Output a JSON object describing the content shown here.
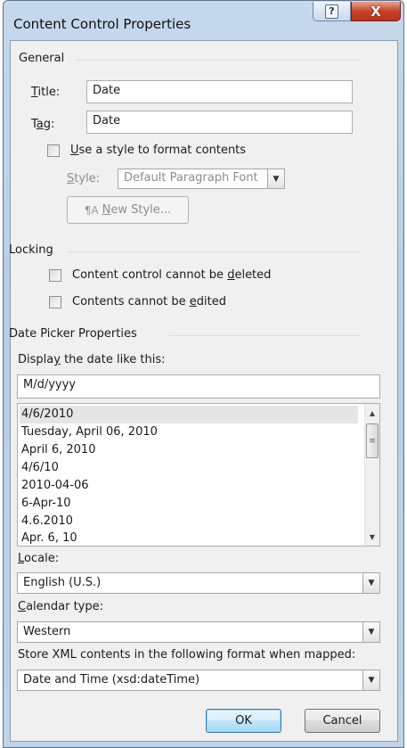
{
  "window": {
    "title": "Content Control Properties",
    "help_glyph": "?",
    "close_glyph": "X"
  },
  "general": {
    "heading": "General",
    "title_label": "Title:",
    "title_value": "Date",
    "tag_label": "Tag:",
    "tag_value": "Date",
    "use_style_label": "Use a style to format contents",
    "use_style_checked": false,
    "style_label": "Style:",
    "style_value": "Default Paragraph Font",
    "new_style_label": "New Style..."
  },
  "locking": {
    "heading": "Locking",
    "cannot_delete_label": "Content control cannot be deleted",
    "cannot_delete_checked": false,
    "cannot_edit_label": "Contents cannot be edited",
    "cannot_edit_checked": false
  },
  "date_picker": {
    "heading": "Date Picker Properties",
    "display_label": "Display the date like this:",
    "format_value": "M/d/yyyy",
    "formats": [
      "4/6/2010",
      "Tuesday, April 06, 2010",
      "April 6, 2010",
      "4/6/10",
      "2010-04-06",
      "6-Apr-10",
      "4.6.2010",
      "Apr. 6, 10"
    ],
    "selected_format_index": 0,
    "locale_label": "Locale:",
    "locale_value": "English (U.S.)",
    "calendar_label": "Calendar type:",
    "calendar_value": "Western",
    "xml_label": "Store XML contents in the following format when mapped:",
    "xml_value": "Date and Time (xsd:dateTime)"
  },
  "buttons": {
    "ok_label": "OK",
    "cancel_label": "Cancel"
  },
  "colors": {
    "title_bar": "#b9cde5",
    "close_button": "#c8432a",
    "dialog_background": "#f0f0f0",
    "selection": "#e5e5e5"
  }
}
